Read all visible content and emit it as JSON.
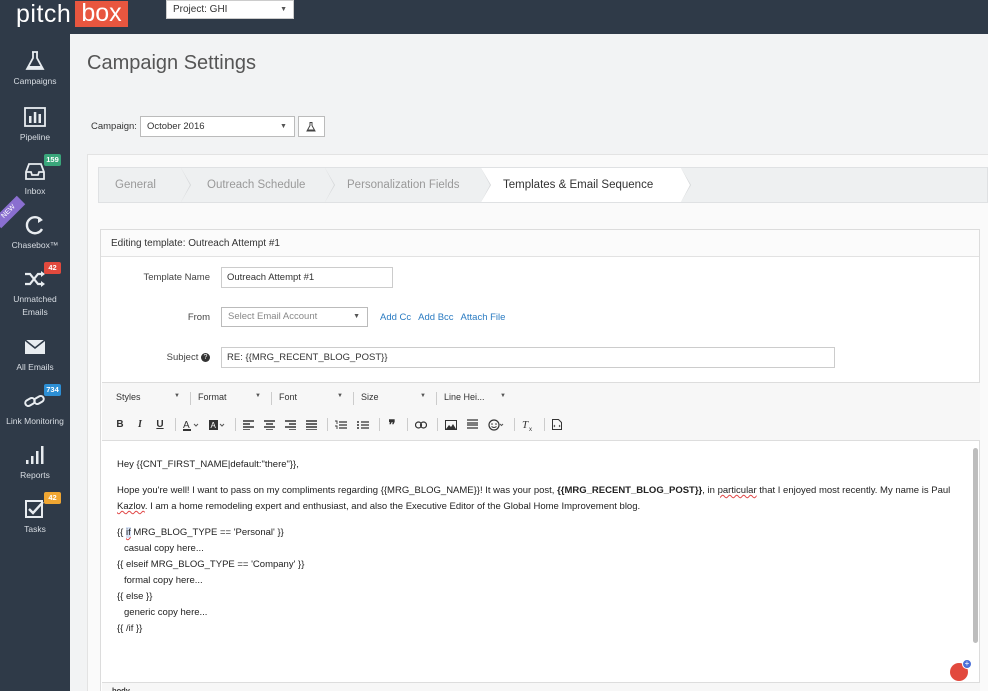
{
  "brand": {
    "part1": "pitch",
    "part2": "box"
  },
  "project_select": {
    "value": "Project: GHI"
  },
  "sidebar": {
    "new_label": "NEW",
    "items": [
      {
        "label": "Campaigns",
        "icon": "flask-icon",
        "badge": ""
      },
      {
        "label": "Pipeline",
        "icon": "bar-chart-icon",
        "badge": ""
      },
      {
        "label": "Inbox",
        "icon": "inbox-icon",
        "badge": "159",
        "badge_color": "#3aa67b"
      },
      {
        "label": "Chasebox™",
        "icon": "refresh-icon",
        "badge": ""
      },
      {
        "label": "Unmatched Emails",
        "icon": "shuffle-icon",
        "badge": "42",
        "badge_color": "#e2493d"
      },
      {
        "label": "All Emails",
        "icon": "envelope-icon",
        "badge": ""
      },
      {
        "label": "Link Monitoring",
        "icon": "link-icon",
        "badge": "734",
        "badge_color": "#2d8fd5"
      },
      {
        "label": "Reports",
        "icon": "signal-icon",
        "badge": ""
      },
      {
        "label": "Tasks",
        "icon": "checkbox-icon",
        "badge": "42",
        "badge_color": "#f0a632"
      }
    ]
  },
  "page": {
    "title": "Campaign Settings"
  },
  "campaign": {
    "label": "Campaign:",
    "value": "October 2016"
  },
  "wizard": {
    "steps": [
      "General",
      "Outreach Schedule",
      "Personalization Fields",
      "Templates & Email Sequence"
    ],
    "active": 3
  },
  "template": {
    "header": "Editing template: Outreach Attempt #1",
    "name_label": "Template Name",
    "name_value": "Outreach Attempt #1",
    "from_label": "From",
    "from_placeholder": "Select Email Account",
    "add_cc": "Add Cc",
    "add_bcc": "Add Bcc",
    "attach_file": "Attach File",
    "subject_label": "Subject",
    "subject_value": "RE: {{MRG_RECENT_BLOG_POST}}"
  },
  "toolbar": {
    "combos": [
      "Styles",
      "Format",
      "Font",
      "Size",
      "Line Hei..."
    ],
    "buttons": [
      "B",
      "I",
      "U"
    ]
  },
  "editor": {
    "line1": "Hey {{CNT_FIRST_NAME|default:\"there\"}},",
    "p2_a": "Hope you're well! I want to pass on my compliments regarding {{MRG_BLOG_NAME}}! It was your post, ",
    "p2_b": "{{MRG_RECENT_BLOG_POST}}",
    "p2_c": ", in ",
    "p2_d": "particular",
    "p2_e": " that I enjoyed most recently. My name is Paul ",
    "p2_f": "Kazlov",
    "p2_g": ". I am a home remodeling expert and enthusiast, and also the Executive Editor of the Global Home Improvement blog.",
    "c1_a": "{{ ",
    "c1_b": "if",
    "c1_c": " MRG_BLOG_TYPE == 'Personal' }}",
    "c2": "casual copy here...",
    "c3": "{{ elseif MRG_BLOG_TYPE == 'Company' }}",
    "c4": "formal copy here...",
    "c5": "{{ else }}",
    "c6": "generic copy here...",
    "c7": "{{ /if }}",
    "status": "body"
  }
}
